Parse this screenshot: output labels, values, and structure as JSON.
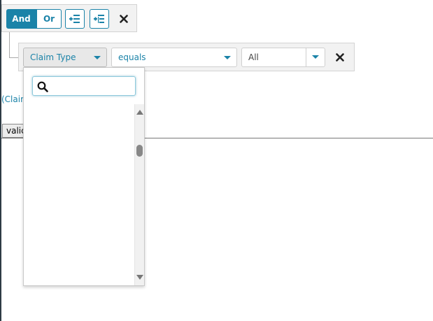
{
  "group": {
    "and_label": "And",
    "or_label": "Or",
    "icons": [
      "add-rule-icon",
      "add-group-icon",
      "delete-icon"
    ]
  },
  "rule": {
    "field_value": "Claim Type",
    "operator_value": "equals",
    "value_value": "All",
    "delete_icon": "delete-icon"
  },
  "dropdown": {
    "search_placeholder": "",
    "search_icon": "search-icon"
  },
  "background": {
    "preview_text": "(Claim",
    "validate_label": "valic"
  },
  "colors": {
    "accent": "#1b83a8",
    "panel_bg": "#f2f2f2"
  }
}
